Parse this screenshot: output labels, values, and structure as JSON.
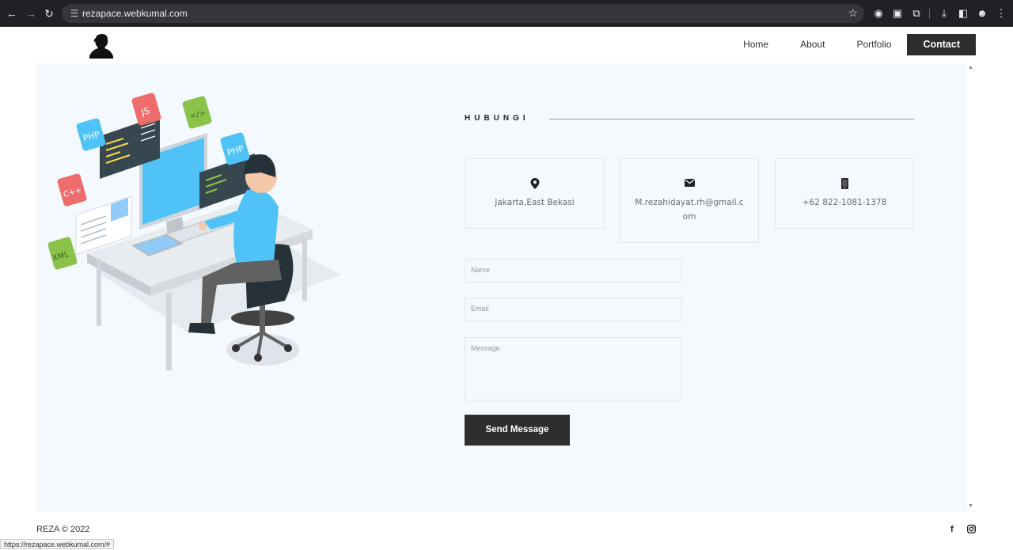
{
  "browser": {
    "url": "rezapace.webkumal.com",
    "status_url": "https://rezapace.webkumal.com/#"
  },
  "nav": {
    "items": [
      {
        "label": "Home"
      },
      {
        "label": "About"
      },
      {
        "label": "Portfolio"
      },
      {
        "label": "Contact"
      }
    ],
    "active": "Contact"
  },
  "contact": {
    "heading": "HUBUNGI",
    "cards": [
      {
        "icon": "map-pin-icon",
        "text": "Jakarta,East Bekasi"
      },
      {
        "icon": "envelope-icon",
        "text": "M.rezahidayat.rh@gmail.com"
      },
      {
        "icon": "phone-icon",
        "text": "+62 822-1081-1378"
      }
    ],
    "form": {
      "name_placeholder": "Name",
      "email_placeholder": "Email",
      "message_placeholder": "Message",
      "submit_label": "Send Message"
    }
  },
  "illustration": {
    "badges": [
      "PHP",
      "JS",
      "</>",
      "PHP",
      "C++",
      "XML"
    ]
  },
  "footer": {
    "copyright": "REZA © 2022",
    "social": [
      {
        "icon": "facebook-icon",
        "glyph": "f"
      },
      {
        "icon": "instagram-icon",
        "glyph": "◙"
      }
    ]
  },
  "colors": {
    "panel_bg": "#f4f9fd",
    "button_bg": "#2e2e2e",
    "accent_blue": "#4fc3f7"
  }
}
